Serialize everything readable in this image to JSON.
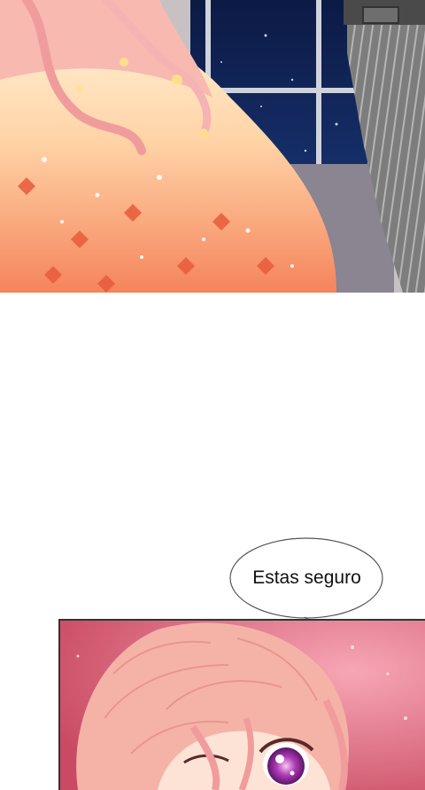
{
  "speech_bubble": {
    "text": "Estas seguro"
  }
}
